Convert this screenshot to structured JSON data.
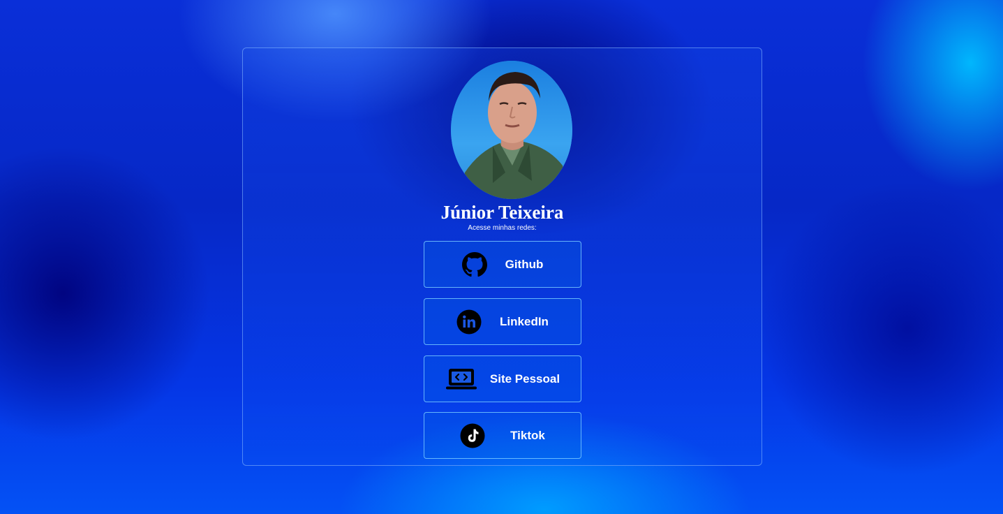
{
  "profile": {
    "name": "Júnior Teixeira",
    "subtitle": "Acesse minhas redes:"
  },
  "links": [
    {
      "label": "Github",
      "icon": "github-icon"
    },
    {
      "label": "LinkedIn",
      "icon": "linkedin-icon"
    },
    {
      "label": "Site Pessoal",
      "icon": "laptop-code-icon"
    },
    {
      "label": "Tiktok",
      "icon": "tiktok-icon"
    }
  ],
  "colors": {
    "background_primary": "#0628c6",
    "card_border": "#8cbeff",
    "button_border": "#78c8ff",
    "text": "#ffffff",
    "icon": "#000000"
  }
}
